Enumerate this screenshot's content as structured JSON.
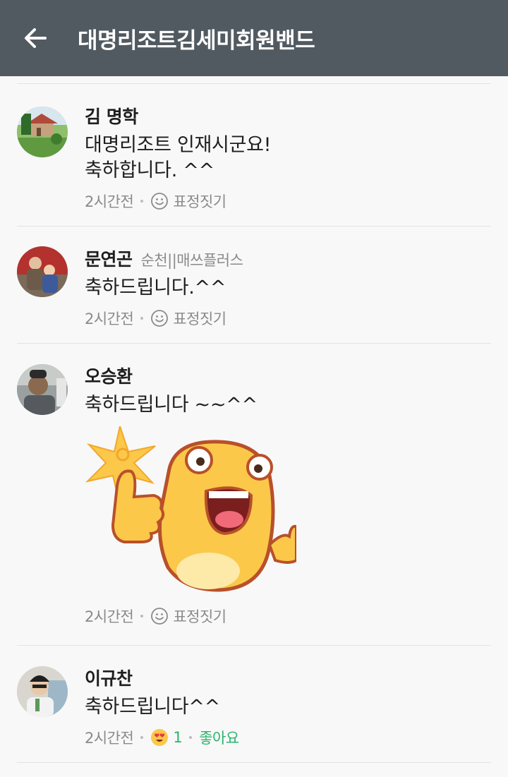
{
  "header": {
    "title": "대명리조트김세미회원밴드",
    "back_icon": "arrow-left-icon"
  },
  "comments": [
    {
      "name": "김 명학",
      "affiliation": "",
      "text_lines": [
        "대명리조트 인재시군요!",
        "축하합니다. ^^"
      ],
      "time": "2시간전",
      "react_label": "표정짓기"
    },
    {
      "name": "문연곤",
      "affiliation": "순천||매쓰플러스",
      "text_lines": [
        "축하드립니다.^^"
      ],
      "time": "2시간전",
      "react_label": "표정짓기"
    },
    {
      "name": "오승환",
      "affiliation": "",
      "text_lines": [
        "축하드립니다 ~~^^"
      ],
      "sticker": "thumbs-up-character-sticker",
      "time": "2시간전",
      "react_label": "표정짓기"
    },
    {
      "name": "이규찬",
      "affiliation": "",
      "text_lines": [
        "축하드립니다^^"
      ],
      "time": "2시간전",
      "reaction_count": "1",
      "like_label": "좋아요"
    }
  ],
  "colors": {
    "header_bg": "#525a61",
    "accent_green": "#2cb46c",
    "meta_gray": "#8a8a8a"
  }
}
